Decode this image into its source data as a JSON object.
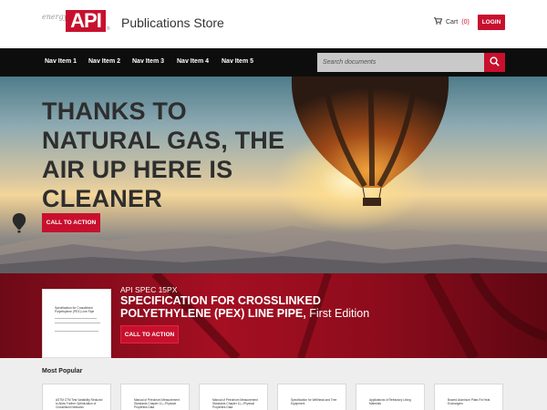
{
  "header": {
    "logo": {
      "energy": "energy",
      "api": "API",
      "reg": "®"
    },
    "store_title": "Publications Store",
    "cart_label": "Cart",
    "cart_count": "(0)",
    "login_label": "LOGIN"
  },
  "nav": {
    "items": [
      {
        "label": "Nav Item 1"
      },
      {
        "label": "Nav Item 2"
      },
      {
        "label": "Nav Item 3"
      },
      {
        "label": "Nav Item 4"
      },
      {
        "label": "Nav Item 5"
      }
    ],
    "search_placeholder": "Search documents"
  },
  "hero": {
    "headline": "THANKS TO NATURAL GAS, THE AIR UP HERE IS CLEANER",
    "cta_label": "CALL TO ACTION"
  },
  "featured": {
    "doc_code": "API SPEC 15PX",
    "title": "SPECIFICATION FOR CROSSLINKED POLYETHYLENE (PEX) LINE PIPE,",
    "edition": " First Edition",
    "thumb_title": "Specification for Crosslinked Polyethylene (PEX) Line Pipe",
    "cta_label": "CALL TO ACTION"
  },
  "popular": {
    "title": "Most Popular",
    "items": [
      {
        "text": "ASTM CTM Test Variability Reduced to Allow Further Optimization of Crosslinked Networks"
      },
      {
        "text": "Manual of Petroleum Measurement Standards Chapter 11—Physical Properties Data"
      },
      {
        "text": "Manual of Petroleum Measurement Standards Chapter 11—Physical Properties Data"
      },
      {
        "text": "Specification for Wellhead and Tree Equipment"
      },
      {
        "text": "Applications of Refractory Lining Materials"
      },
      {
        "text": "Brazed Aluminum Plate-Fin Heat Exchangers"
      }
    ]
  },
  "colors": {
    "brand_red": "#c8102e",
    "nav_bg": "#0d0d0d",
    "featured_bg": "#a50f22"
  }
}
